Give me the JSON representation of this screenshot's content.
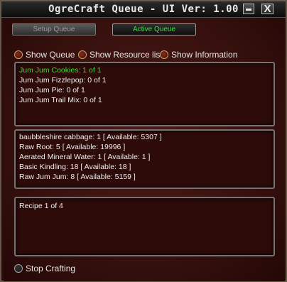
{
  "window": {
    "title": "OgreCraft Queue - UI Ver: 1.00",
    "minimize_label": "",
    "close_label": "X"
  },
  "tabs": [
    {
      "label": "Setup Queue",
      "active": false
    },
    {
      "label": "Active Queue",
      "active": true
    }
  ],
  "options": [
    {
      "label": "Show Queue"
    },
    {
      "label": "Show Resource list"
    },
    {
      "label": "Show Information"
    }
  ],
  "queue": [
    {
      "text": "Jum Jum Cookies: 1 of 1",
      "active": true
    },
    {
      "text": "Jum Jum Fizzlepop: 0 of 1",
      "active": false
    },
    {
      "text": "Jum Jum Pie: 0 of 1",
      "active": false
    },
    {
      "text": "Jum Jum Trail Mix: 0 of 1",
      "active": false
    }
  ],
  "resources": [
    {
      "text": "baubbleshire cabbage: 1   [ Available: 5307 ]"
    },
    {
      "text": "Raw Root: 5  [ Available: 19996 ]"
    },
    {
      "text": "Aerated Mineral Water: 1  [ Available: 1 ]"
    },
    {
      "text": "Basic Kindling: 18  [ Available: 18 ]"
    },
    {
      "text": "Raw Jum Jum: 8  [ Available: 5159 ]"
    }
  ],
  "information": {
    "text": "Recipe 1 of 4"
  },
  "stop": {
    "label": "Stop Crafting"
  },
  "colors": {
    "active_text": "#2fe02f",
    "background": "#3a120f"
  }
}
